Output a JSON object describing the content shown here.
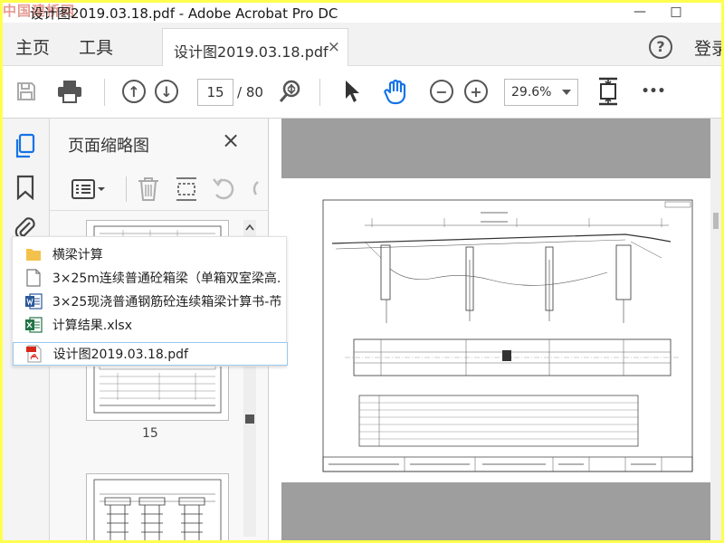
{
  "window": {
    "title": "设计图2019.03.18.pdf - Adobe Acrobat Pro DC",
    "watermark": "中国建桥网",
    "minimize": "—",
    "maximize": "□"
  },
  "menu": {
    "home": "主页",
    "tools": "工具",
    "tab_label": "设计图2019.03.18.pdf",
    "tab_close": "×",
    "help": "?",
    "login": "登录"
  },
  "toolbar": {
    "current_page": "15",
    "total_pages": "/ 80",
    "zoom": "29.6%",
    "more": "•••"
  },
  "panel": {
    "title": "页面缩略图",
    "close": "×",
    "page_label": "15"
  },
  "files": [
    {
      "name": "横梁计算",
      "type": "folder"
    },
    {
      "name": "3×25m连续普通砼箱梁（单箱双室梁高.",
      "type": "document"
    },
    {
      "name": "3×25现浇普通钢筋砼连续箱梁计算书-芇",
      "type": "word"
    },
    {
      "name": "计算结果.xlsx",
      "type": "excel"
    },
    {
      "name": "设计图2019.03.18.pdf",
      "type": "pdf"
    }
  ],
  "colors": {
    "accent": "#1473e6",
    "frame": "#ffff4d",
    "word": "#2b579a",
    "excel": "#217346",
    "pdf": "#d9281a",
    "folder": "#f3c24d"
  }
}
